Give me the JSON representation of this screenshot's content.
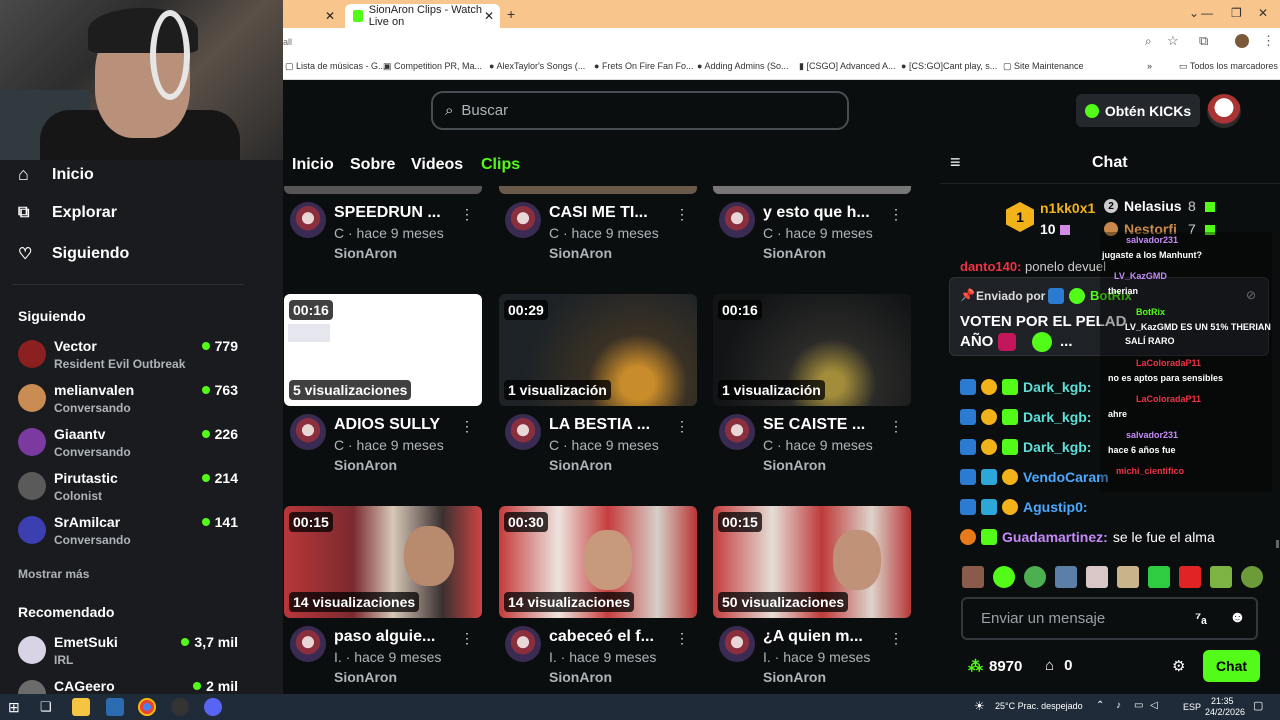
{
  "browser": {
    "tabs": [
      {
        "label": ""
      },
      {
        "label": "SionAron Clips - Watch Live on"
      }
    ],
    "address": "all",
    "bookmarks": [
      "Lista de músicas - G...",
      "Competition PR, Ma...",
      "AlexTaylor's Songs (...",
      "Frets On Fire Fan Fo...",
      "Adding Admins (So...",
      "[CSGO] Advanced A...",
      "[CS:GO]Cant play, s...",
      "Site Maintenance",
      "Todos los marcadores"
    ]
  },
  "header": {
    "search_placeholder": "Buscar",
    "get_kicks": "Obtén KICKs"
  },
  "sidebar": {
    "nav": [
      "Inicio",
      "Explorar",
      "Siguiendo"
    ],
    "following_title": "Siguiendo",
    "following": [
      {
        "name": "Vector",
        "category": "Resident Evil Outbreak",
        "viewers": "779"
      },
      {
        "name": "melianvalen",
        "category": "Conversando",
        "viewers": "763"
      },
      {
        "name": "Giaantv",
        "category": "Conversando",
        "viewers": "226"
      },
      {
        "name": "Pirutastic",
        "category": "Colonist",
        "viewers": "214"
      },
      {
        "name": "SrAmilcar",
        "category": "Conversando",
        "viewers": "141"
      }
    ],
    "show_more": "Mostrar más",
    "recommended_title": "Recomendado",
    "recommended": [
      {
        "name": "EmetSuki",
        "category": "IRL",
        "viewers": "3,7 mil"
      },
      {
        "name": "CAGeero",
        "category": "",
        "viewers": "2 mil"
      }
    ]
  },
  "channel_tabs": [
    "Inicio",
    "Sobre",
    "Videos",
    "Clips"
  ],
  "clips": [
    {
      "title": "SPEEDRUN ...",
      "meta": "C · hace 9 meses",
      "channel": "SionAron",
      "duration": "",
      "views": ""
    },
    {
      "title": "CASI ME TI...",
      "meta": "C · hace 9 meses",
      "channel": "SionAron",
      "duration": "",
      "views": ""
    },
    {
      "title": "y esto que h...",
      "meta": "C · hace 9 meses",
      "channel": "SionAron",
      "duration": "",
      "views": ""
    },
    {
      "title": "ADIOS SULLY",
      "meta": "C · hace 9 meses",
      "channel": "SionAron",
      "duration": "00:16",
      "views": "5 visualizaciones"
    },
    {
      "title": "LA BESTIA ...",
      "meta": "C · hace 9 meses",
      "channel": "SionAron",
      "duration": "00:29",
      "views": "1 visualización"
    },
    {
      "title": "SE CAISTE ...",
      "meta": "C · hace 9 meses",
      "channel": "SionAron",
      "duration": "00:16",
      "views": "1 visualización"
    },
    {
      "title": "paso alguie...",
      "meta": "I. · hace 9 meses",
      "channel": "SionAron",
      "duration": "00:15",
      "views": "14 visualizaciones"
    },
    {
      "title": "cabeceó el f...",
      "meta": "I. · hace 9 meses",
      "channel": "SionAron",
      "duration": "00:30",
      "views": "14 visualizaciones"
    },
    {
      "title": "¿A quien m...",
      "meta": "I. · hace 9 meses",
      "channel": "SionAron",
      "duration": "00:15",
      "views": "50 visualizaciones"
    }
  ],
  "chat": {
    "title": "Chat",
    "leaderboard": {
      "first": {
        "name": "n1kk0x1",
        "count": "10"
      },
      "second": {
        "name": "Nelasius",
        "count": "8"
      },
      "third": {
        "name": "Nestorfi",
        "count": "7"
      }
    },
    "pinned": {
      "label": "Enviado por",
      "author": "BotRix",
      "text": "VOTEN POR EL PELAD",
      "text2": "AÑO",
      "ellipsis": "..."
    },
    "partial_line": "ponelo devuel",
    "messages": [
      {
        "user": "Dark_kgb:",
        "text": ""
      },
      {
        "user": "Dark_kgb:",
        "text": ""
      },
      {
        "user": "Dark_kgb:",
        "text": ""
      },
      {
        "user": "VendoCaram",
        "text": ""
      },
      {
        "user": "Agustip0:",
        "text": ""
      },
      {
        "user": "Guadamartinez:",
        "text": "se le fue el alma"
      }
    ],
    "overlay": [
      {
        "user": "salvador231",
        "text": "jugaste a los Manhunt?"
      },
      {
        "user": "LV_KazGMD",
        "text": "therian"
      },
      {
        "user": "BotRix",
        "text": ""
      },
      {
        "user": "",
        "text": "LV_KazGMD ES UN 51% THERIAN"
      },
      {
        "user": "",
        "text": "SALÍ RARO"
      },
      {
        "user": "LaColoradaP11",
        "text": "no es aptos para sensibles"
      },
      {
        "user": "LaColoradaP11",
        "text": "ahre"
      },
      {
        "user": "salvador231",
        "text": "hace 6 años fue"
      },
      {
        "user": "michi_cientifico",
        "text": ""
      }
    ],
    "input_placeholder": "Enviar un mensaje",
    "points": "8970",
    "store_count": "0",
    "send_label": "Chat"
  },
  "taskbar": {
    "weather": "25°C  Prac. despejado",
    "lang": "ESP",
    "time": "21:35",
    "date": "24/2/2026"
  },
  "colors": {
    "accent": "#53fc18",
    "background": "#0b0e0f",
    "sidebar": "#191b1f"
  }
}
